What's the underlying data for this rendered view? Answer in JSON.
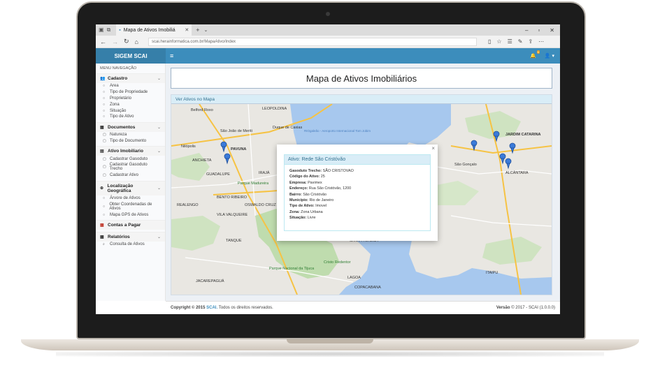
{
  "browser": {
    "tab_title": "Mapa de Ativos Imobiliá",
    "url": "scai.herainformatica.com.br/MapaAtivo/Index"
  },
  "app": {
    "brand": "SIGEM SCAI",
    "notification_count": "6",
    "accent": "#3c8dbc"
  },
  "sidebar": {
    "header": "MENU NAVEGAÇÃO",
    "sections": [
      {
        "label": "Cadastro",
        "icon": "users-icon",
        "items": [
          "Area",
          "Tipo de Propriedade",
          "Proprietário",
          "Zona",
          "Situação",
          "Tipo de Ativo"
        ]
      },
      {
        "label": "Documentos",
        "icon": "book-icon",
        "items": [
          "Natureza",
          "Tipo de Documento"
        ]
      },
      {
        "label": "Ativo Imobiliario",
        "icon": "list-icon",
        "items": [
          "Cadastrar Gasoduto",
          "Cadastrar Gasoduto Trecho",
          "Cadastrar Ativo"
        ]
      },
      {
        "label": "Localização Geográfica",
        "icon": "globe-icon",
        "items": [
          "Árvore de Ativos",
          "Obter Coordenadas de Ativos",
          "Mapa GPS de Ativos"
        ]
      },
      {
        "label": "Contas a Pagar",
        "icon": "calendar-icon",
        "items": []
      },
      {
        "label": "Relatórios",
        "icon": "table-icon",
        "items": [
          "Consulta de Ativos"
        ]
      }
    ]
  },
  "page": {
    "title": "Mapa de Ativos Imobiliários",
    "map_panel_title": "Ver Ativos no Mapa"
  },
  "map": {
    "labels": [
      "Belford Roxo",
      "LEOPOLDINA",
      "São João de Meriti",
      "Duque de Caxias",
      "Nilópolis",
      "PAVUNA",
      "ANCHIETA",
      "IRAJÁ",
      "GUADALUPE",
      "Parque Madureira",
      "BENTO RIBEIRO",
      "OSWALDO CRUZ",
      "REALENGO",
      "VILA VALQUEIRE",
      "TANQUE",
      "SANTA TERESA",
      "Cristo Redentor",
      "Parque Nacional da Tijuca",
      "JACAREPAGUÁ",
      "LAGOA",
      "COPACABANA",
      "JARDIM CATARINA",
      "São Gonçalo",
      "ALCÂNTARA",
      "ITAIPU",
      "RIOgaleão - Aeroporto Internacional Tom Jobim"
    ]
  },
  "modal": {
    "title": "Ativo: Rede São Cristóvão",
    "fields": [
      {
        "label": "Gasoduto Trecho:",
        "value": "SÃO CRISTOVAO"
      },
      {
        "label": "Código do Ativo:",
        "value": "25"
      },
      {
        "label": "Empresa:",
        "value": "Pavimex"
      },
      {
        "label": "Endereço:",
        "value": "Rua São Cristóvão, 1200"
      },
      {
        "label": "Bairro:",
        "value": "São Cristóvão"
      },
      {
        "label": "Município:",
        "value": "Rio de Janeiro"
      },
      {
        "label": "Tipo de Ativo:",
        "value": "Imovel"
      },
      {
        "label": "Zona:",
        "value": "Zona Urbana"
      },
      {
        "label": "Situação:",
        "value": "Livre"
      }
    ]
  },
  "footer": {
    "copyright_prefix": "Copyright © 2015",
    "brand": "SCAI.",
    "rights": "Todos os direitos reservados.",
    "version_label": "Versão",
    "version_text": "© 2017 - SCAI (1.0.0.0)"
  }
}
